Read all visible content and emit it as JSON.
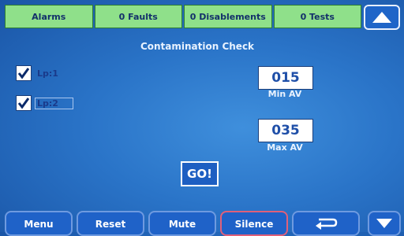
{
  "status_bar": {
    "alarms": "Alarms",
    "faults": "0 Faults",
    "disablements": "0 Disablements",
    "tests": "0 Tests"
  },
  "title": "Contamination Check",
  "loops": [
    {
      "label": "Lp:1",
      "checked": true
    },
    {
      "label": "Lp:2",
      "checked": true
    }
  ],
  "min_av": {
    "value": "015",
    "caption": "Min AV"
  },
  "max_av": {
    "value": "035",
    "caption": "Max AV"
  },
  "go_label": "GO!",
  "nav": {
    "menu": "Menu",
    "reset": "Reset",
    "mute": "Mute",
    "silence": "Silence"
  },
  "icons": {
    "up": "up-arrow-icon",
    "back": "return-arrow-icon",
    "down": "down-arrow-icon"
  },
  "colors": {
    "status_green": "#8fe08a",
    "button_blue": "#1f62c8",
    "silence_border": "#e0607a"
  }
}
